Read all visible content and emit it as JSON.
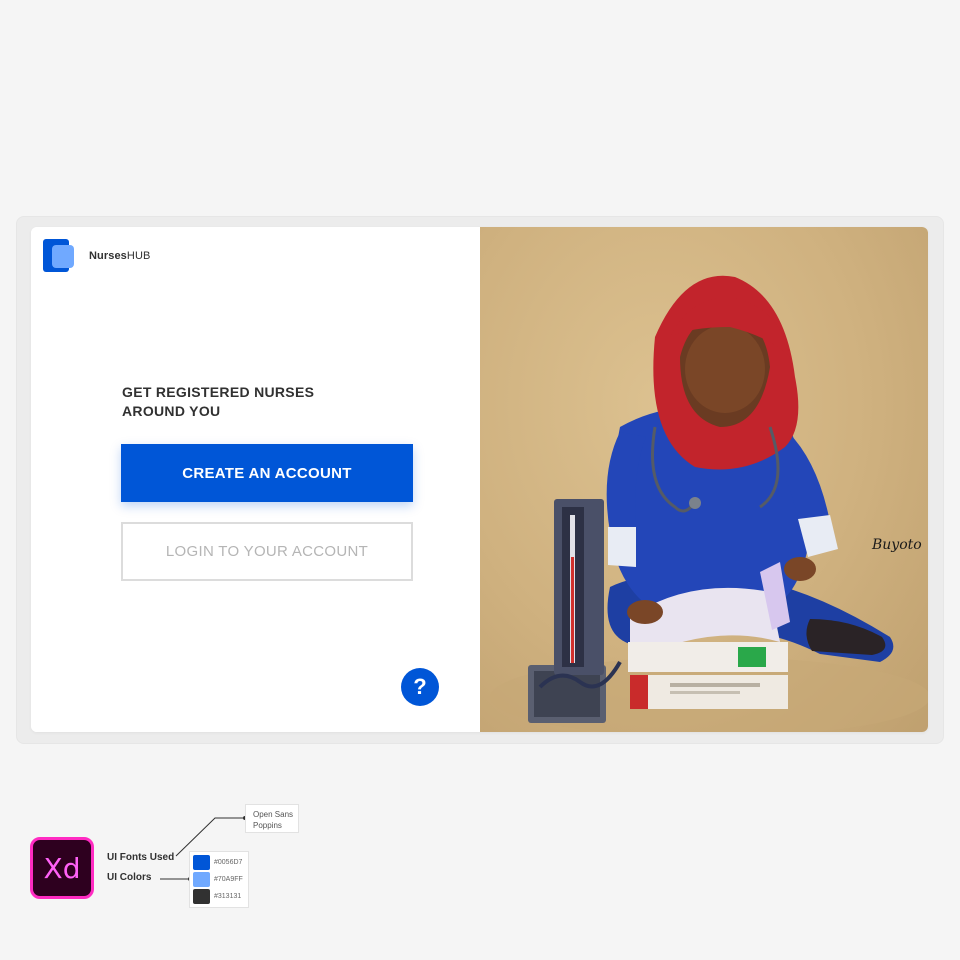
{
  "app": {
    "name_bold": "Nurses",
    "name_regular": "HUB"
  },
  "hero": {
    "headline_line1": "GET REGISTERED NURSES",
    "headline_line2": "AROUND YOU"
  },
  "buttons": {
    "create_account": "CREATE AN ACCOUNT",
    "login": "LOGIN TO YOUR ACCOUNT",
    "help": "?"
  },
  "annotation": {
    "xd_label": "Xd",
    "fonts_title": "UI Fonts Used",
    "colors_title": "UI Colors",
    "fonts": [
      "Open Sans",
      "Poppins"
    ],
    "colors": [
      {
        "hex": "#0056D7",
        "label": "#0056D7"
      },
      {
        "hex": "#70A9FF",
        "label": "#70A9FF"
      },
      {
        "hex": "#313131",
        "label": "#313131"
      }
    ]
  },
  "photo": {
    "signature": "Buyoto"
  },
  "theme": {
    "primary": "#0056D7",
    "secondary": "#70A9FF",
    "text": "#313131"
  }
}
